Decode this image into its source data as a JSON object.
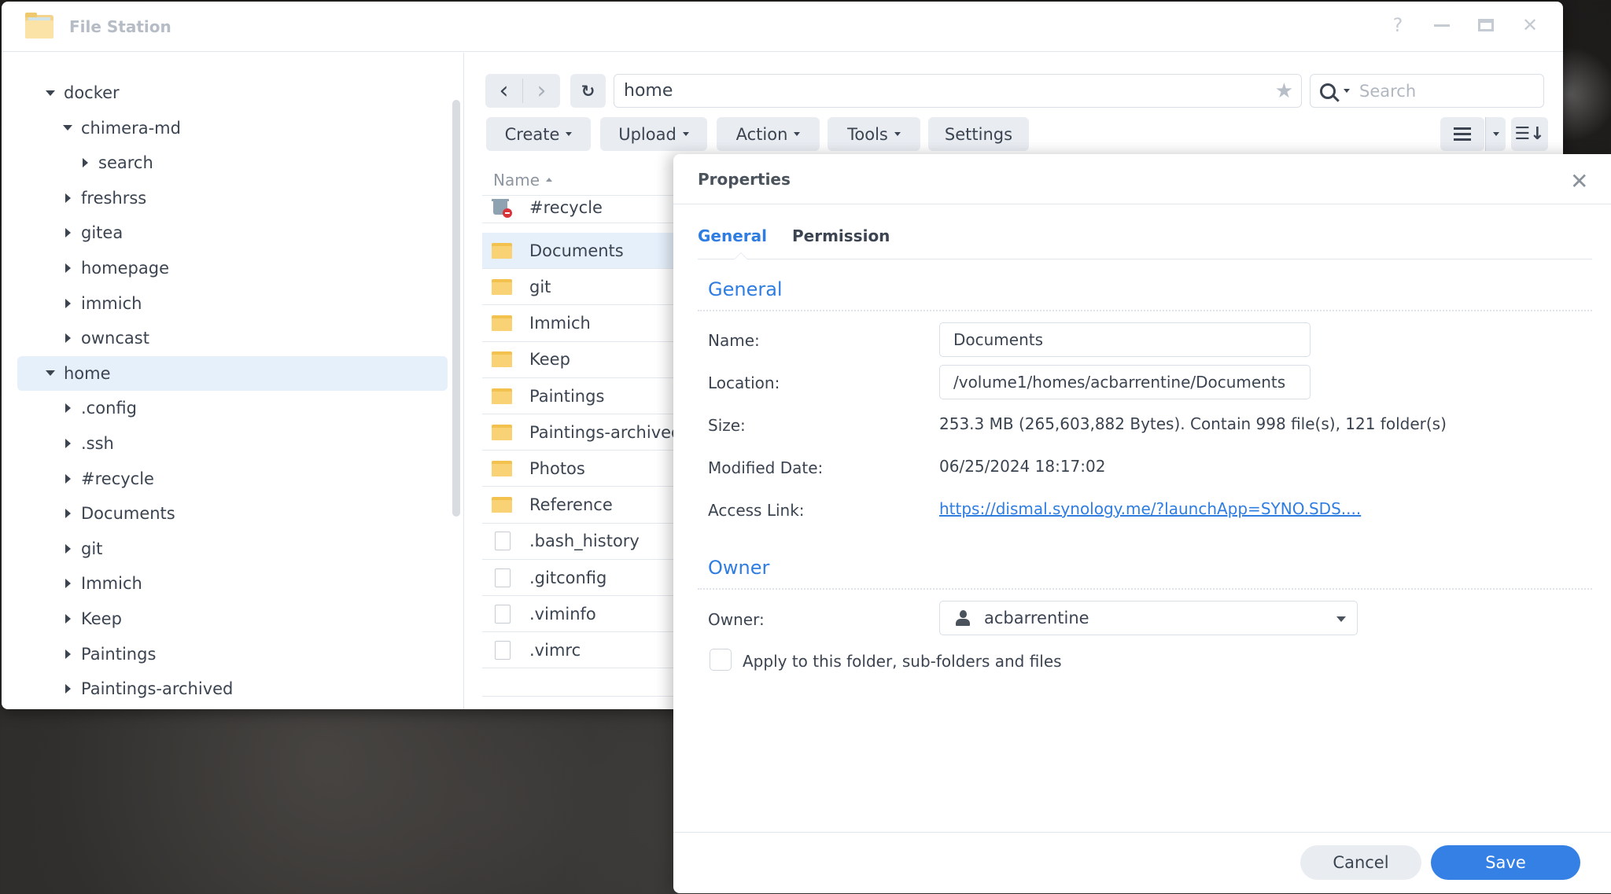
{
  "window": {
    "title": "File Station",
    "controls": {
      "help": "?",
      "minimize": "minimize",
      "maximize": "maximize",
      "close": "✕"
    }
  },
  "sidebar": {
    "tree": [
      {
        "label": "docker",
        "level": 0,
        "expanded": true
      },
      {
        "label": "chimera-md",
        "level": 1,
        "expanded": true
      },
      {
        "label": "search",
        "level": 2,
        "expanded": false
      },
      {
        "label": "freshrss",
        "level": 1,
        "expanded": false
      },
      {
        "label": "gitea",
        "level": 1,
        "expanded": false
      },
      {
        "label": "homepage",
        "level": 1,
        "expanded": false
      },
      {
        "label": "immich",
        "level": 1,
        "expanded": false
      },
      {
        "label": "owncast",
        "level": 1,
        "expanded": false
      },
      {
        "label": "home",
        "level": 0,
        "expanded": true,
        "selected": true
      },
      {
        "label": ".config",
        "level": 1,
        "expanded": false
      },
      {
        "label": ".ssh",
        "level": 1,
        "expanded": false
      },
      {
        "label": "#recycle",
        "level": 1,
        "expanded": false
      },
      {
        "label": "Documents",
        "level": 1,
        "expanded": false
      },
      {
        "label": "git",
        "level": 1,
        "expanded": false
      },
      {
        "label": "Immich",
        "level": 1,
        "expanded": false
      },
      {
        "label": "Keep",
        "level": 1,
        "expanded": false
      },
      {
        "label": "Paintings",
        "level": 1,
        "expanded": false
      },
      {
        "label": "Paintings-archived",
        "level": 1,
        "expanded": false
      }
    ]
  },
  "toolbar": {
    "back": "‹",
    "forward": "›",
    "refresh": "↻",
    "path": "home",
    "favorite": "★",
    "search_placeholder": "Search",
    "buttons": {
      "create": "Create",
      "upload": "Upload",
      "action": "Action",
      "tools": "Tools",
      "settings": "Settings"
    }
  },
  "file_list": {
    "column_name": "Name",
    "rows": [
      {
        "name": "#recycle",
        "type": "recycle"
      },
      {
        "name": "Documents",
        "type": "folder",
        "selected": true
      },
      {
        "name": "git",
        "type": "folder"
      },
      {
        "name": "Immich",
        "type": "folder"
      },
      {
        "name": "Keep",
        "type": "folder"
      },
      {
        "name": "Paintings",
        "type": "folder"
      },
      {
        "name": "Paintings-archived",
        "type": "folder"
      },
      {
        "name": "Photos",
        "type": "folder"
      },
      {
        "name": "Reference",
        "type": "folder"
      },
      {
        "name": ".bash_history",
        "type": "file"
      },
      {
        "name": ".gitconfig",
        "type": "file"
      },
      {
        "name": ".viminfo",
        "type": "file"
      },
      {
        "name": ".vimrc",
        "type": "file"
      }
    ]
  },
  "properties": {
    "title": "Properties",
    "close": "✕",
    "tabs": {
      "general": "General",
      "permission": "Permission"
    },
    "general_section": "General",
    "labels": {
      "name": "Name:",
      "location": "Location:",
      "size": "Size:",
      "modified": "Modified Date:",
      "access_link": "Access Link:"
    },
    "values": {
      "name": "Documents",
      "location": "/volume1/homes/acbarrentine/Documents",
      "size": "253.3 MB (265,603,882 Bytes). Contain 998 file(s), 121 folder(s)",
      "modified": "06/25/2024 18:17:02",
      "access_link": "https://dismal.synology.me/?launchApp=SYNO.SDS...."
    },
    "owner_section": "Owner",
    "owner_label": "Owner:",
    "owner_value": "acbarrentine",
    "apply_checkbox_label": "Apply to this folder, sub-folders and files",
    "apply_checked": false,
    "cancel": "Cancel",
    "save": "Save",
    "accent_color": "#2f7de1"
  }
}
